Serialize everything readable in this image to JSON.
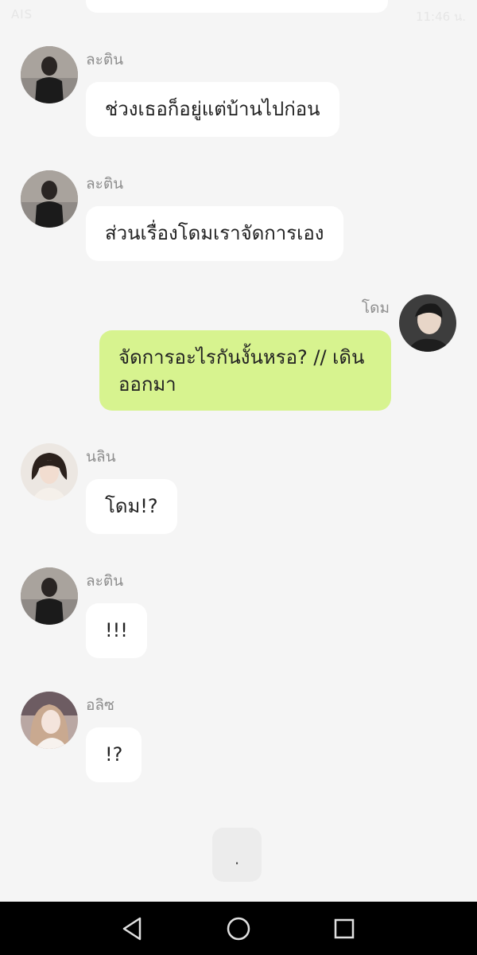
{
  "status_bar": {
    "carrier": "AIS",
    "time": "11:46 น."
  },
  "messages": [
    {
      "sender": "ละติน",
      "text": "ช่วงเธอก็อยู่แต่บ้านไปก่อน",
      "outgoing": false
    },
    {
      "sender": "ละติน",
      "text": "ส่วนเรื่องโดมเราจัดการเอง",
      "outgoing": false
    },
    {
      "sender": "โดม",
      "text": "จัดการอะไรกันงั้นหรอ? // เดินออกมา",
      "outgoing": true
    },
    {
      "sender": "นลิน",
      "text": "โดม!?",
      "outgoing": false
    },
    {
      "sender": "ละติน",
      "text": "!!!",
      "outgoing": false
    },
    {
      "sender": "อลิซ",
      "text": "!?",
      "outgoing": false
    }
  ],
  "typing_indicator": ".",
  "colors": {
    "incoming_bubble": "#ffffff",
    "outgoing_bubble": "#d7f38f",
    "background": "#f5f5f5"
  },
  "icons": {
    "nav_back": "back-icon",
    "nav_home": "home-icon",
    "nav_recents": "recents-icon"
  }
}
